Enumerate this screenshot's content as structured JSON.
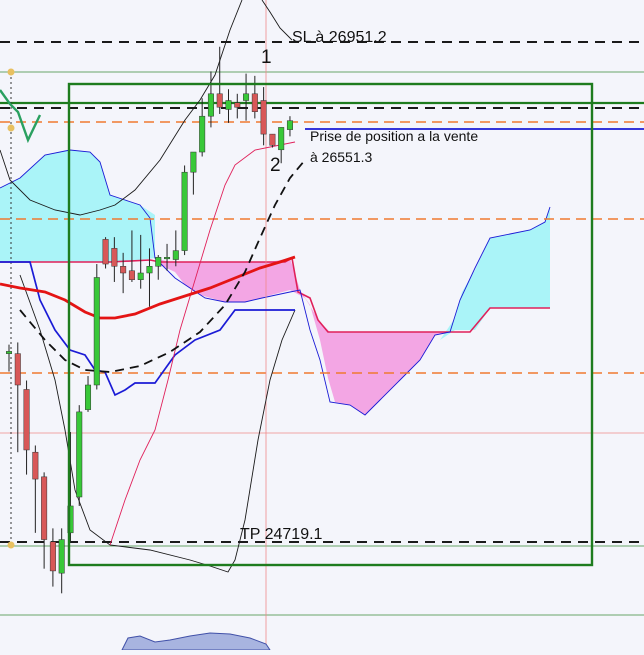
{
  "chart_data": {
    "type": "candlestick",
    "instrument": "",
    "y_range": [
      24490,
      27380
    ],
    "colors": {
      "background": "#f4f5fb",
      "bull_candle": "#38c838",
      "bear_candle": "#d85858",
      "cloud_bull": "#aaf4f8",
      "cloud_bear": "#f3a6e4",
      "tenkan": "#1b1bd6",
      "kijun": "#e0205a",
      "moving_average": "#e41414",
      "bollinger": "#1a1a1a",
      "trade_box": "#1e7c1e",
      "dashed_levels": "#1a1a1a",
      "support_resistance": "#f07a30",
      "projection": "#111111"
    },
    "annotations": {
      "stop_loss": "SL à 26951.2",
      "take_profit": "TP 24719.1",
      "entry_line1": "Prise de position a la vente",
      "entry_line2": "à 26551.3",
      "wave_1": "1",
      "wave_2": "2"
    },
    "levels": {
      "stop_loss": 26951.2,
      "take_profit": 24719.1,
      "entry": 26551.3
    },
    "candles": [
      {
        "o": 25560,
        "h": 25600,
        "l": 25480,
        "c": 25570
      },
      {
        "o": 25560,
        "h": 25610,
        "l": 25120,
        "c": 25420
      },
      {
        "o": 25400,
        "h": 25440,
        "l": 25020,
        "c": 25130
      },
      {
        "o": 25120,
        "h": 25150,
        "l": 24760,
        "c": 25000
      },
      {
        "o": 25010,
        "h": 25030,
        "l": 24600,
        "c": 24730
      },
      {
        "o": 24720,
        "h": 24780,
        "l": 24520,
        "c": 24590
      },
      {
        "o": 24580,
        "h": 24780,
        "l": 24490,
        "c": 24730
      },
      {
        "o": 24760,
        "h": 25210,
        "l": 24720,
        "c": 24880
      },
      {
        "o": 24920,
        "h": 25330,
        "l": 24880,
        "c": 25300
      },
      {
        "o": 25310,
        "h": 25460,
        "l": 25300,
        "c": 25420
      },
      {
        "o": 25420,
        "h": 25960,
        "l": 25400,
        "c": 25900
      },
      {
        "o": 26070,
        "h": 26080,
        "l": 25940,
        "c": 25960
      },
      {
        "o": 26030,
        "h": 26080,
        "l": 25880,
        "c": 25950
      },
      {
        "o": 25950,
        "h": 26010,
        "l": 25830,
        "c": 25920
      },
      {
        "o": 25930,
        "h": 26110,
        "l": 25880,
        "c": 25890
      },
      {
        "o": 25890,
        "h": 26090,
        "l": 25850,
        "c": 25920
      },
      {
        "o": 25920,
        "h": 26030,
        "l": 25770,
        "c": 25950
      },
      {
        "o": 25950,
        "h": 26000,
        "l": 25890,
        "c": 25990
      },
      {
        "o": 25990,
        "h": 26050,
        "l": 25930,
        "c": 25990
      },
      {
        "o": 25980,
        "h": 26110,
        "l": 25950,
        "c": 26020
      },
      {
        "o": 26020,
        "h": 26400,
        "l": 26000,
        "c": 26370
      },
      {
        "o": 26370,
        "h": 26460,
        "l": 26270,
        "c": 26460
      },
      {
        "o": 26460,
        "h": 26700,
        "l": 26440,
        "c": 26620
      },
      {
        "o": 26620,
        "h": 26820,
        "l": 26570,
        "c": 26720
      },
      {
        "o": 26720,
        "h": 26930,
        "l": 26630,
        "c": 26660
      },
      {
        "o": 26650,
        "h": 26740,
        "l": 26590,
        "c": 26690
      },
      {
        "o": 26680,
        "h": 26720,
        "l": 26610,
        "c": 26660
      },
      {
        "o": 26690,
        "h": 26810,
        "l": 26600,
        "c": 26720
      },
      {
        "o": 26720,
        "h": 26800,
        "l": 26610,
        "c": 26640
      },
      {
        "o": 26690,
        "h": 26750,
        "l": 26490,
        "c": 26540
      },
      {
        "o": 26540,
        "h": 26540,
        "l": 26480,
        "c": 26490
      },
      {
        "o": 26470,
        "h": 26570,
        "l": 26410,
        "c": 26570
      },
      {
        "o": 26560,
        "h": 26620,
        "l": 26530,
        "c": 26600
      }
    ]
  }
}
